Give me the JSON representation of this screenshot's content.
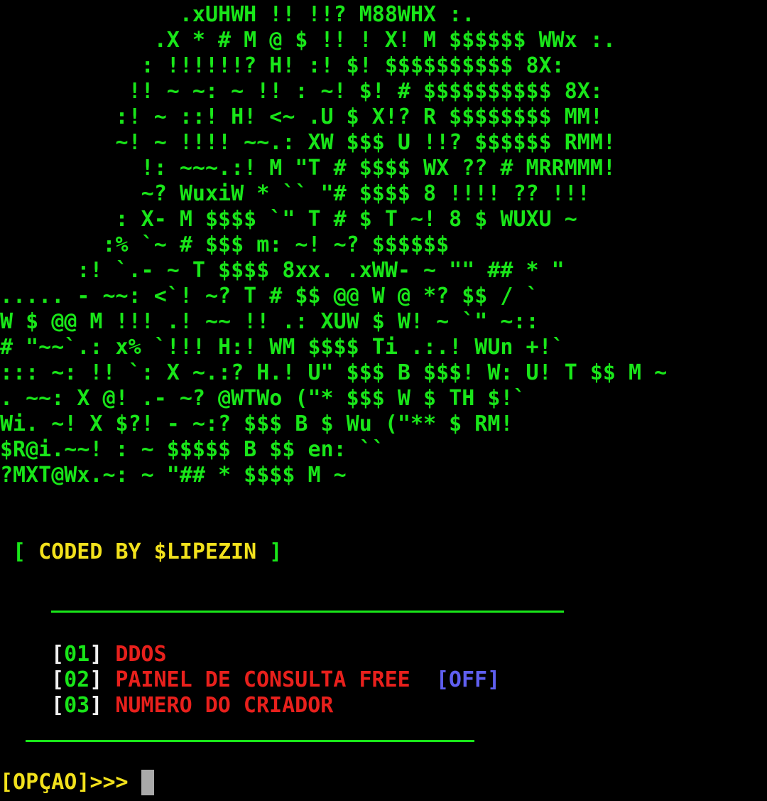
{
  "ascii_art": [
    "              .xUHWH !! !!? M88WHX :.",
    "            .X * # M @ $ !! ! X! M $$$$$$ WWx :.",
    "           : !!!!!!? H! :! $! $$$$$$$$$$ 8X:",
    "          !! ~ ~: ~ !! : ~! $! # $$$$$$$$$$ 8X:",
    "         :! ~ ::! H! <~ .U $ X!? R $$$$$$$$ MM!",
    "         ~! ~ !!!! ~~.: XW $$$ U !!? $$$$$$ RMM!",
    "           !: ~~~.:! M \"T # $$$$ WX ?? # MRRMMM!",
    "           ~? WuxiW * `` \"# $$$$ 8 !!!! ?? !!!",
    "         : X- M $$$$ `\" T # $ T ~! 8 $ WUXU ~",
    "        :% `~ # $$$ m: ~! ~? $$$$$$",
    "      :! `.- ~ T $$$$ 8xx. .xWW- ~ \"\" ## * \"",
    "..... - ~~: <`! ~? T # $$ @@ W @ *? $$ / `",
    "W $ @@ M !!! .! ~~ !! .: XUW $ W! ~ `\" ~::",
    "# \"~~`.: x% `!!! H:! WM $$$$ Ti .:.! WUn +!`",
    "::: ~: !! `: X ~.:? H.! U\" $$$ B $$$! W: U! T $$ M ~",
    ". ~~: X @! .- ~? @WTWo (\"* $$$ W $ TH $!`",
    "Wi. ~! X $?! - ~:? $$$ B $ Wu (\"** $ RM!",
    "$R@i.~~! : ~ $$$$$ B $$ en: ``",
    "?MXT@Wx.~: ~ \"## * $$$$ M ~"
  ],
  "credit": {
    "open_bracket": "[",
    "text": "CODED BY $LIPEZIN",
    "close_bracket": "]"
  },
  "menu": [
    {
      "number": "01",
      "label": "DDOS",
      "status": ""
    },
    {
      "number": "02",
      "label": "PAINEL DE CONSULTA FREE",
      "status": "[OFF]"
    },
    {
      "number": "03",
      "label": "NUMERO DO CRIADOR",
      "status": ""
    }
  ],
  "prompt": {
    "label": "[OPÇAO]",
    "arrows": ">>>",
    "value": ""
  },
  "colors": {
    "background": "#000000",
    "art_green": "#19e619",
    "credit_yellow": "#f2e11c",
    "menu_red": "#e8201c",
    "status_blue": "#5f5ff0",
    "bracket_white": "#f0f0f0",
    "cursor_gray": "#a9a9a9"
  }
}
